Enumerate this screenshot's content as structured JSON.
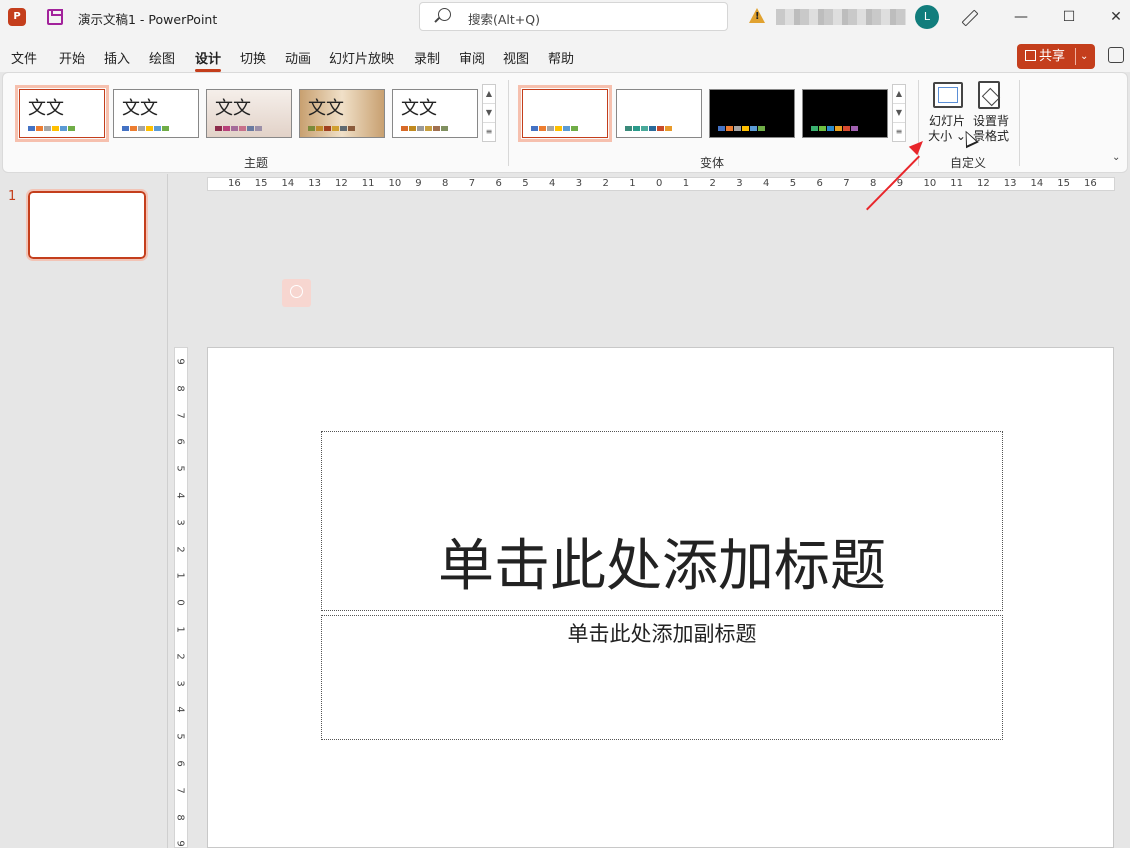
{
  "titlebar": {
    "app_logo": "P",
    "doc_title": "演示文稿1  -  PowerPoint",
    "search_placeholder": "搜索(Alt+Q)",
    "avatar_initial": "L",
    "minimize": "—",
    "maximize": "☐",
    "close": "✕"
  },
  "menu": {
    "items": [
      "文件",
      "开始",
      "插入",
      "绘图",
      "设计",
      "切换",
      "动画",
      "幻灯片放映",
      "录制",
      "审阅",
      "视图",
      "帮助"
    ],
    "active": "设计",
    "share_label": "共享",
    "share_chevron": "⌄"
  },
  "ribbon": {
    "themes_group_label": "主题",
    "variants_group_label": "变体",
    "customize_group_label": "自定义",
    "theme_thumb_text": "文文",
    "theme_thumbs": [
      {
        "text": "文文",
        "swatches": [
          "#4472c4",
          "#ed7d31",
          "#a5a5a5",
          "#ffc000",
          "#5b9bd5",
          "#70ad47"
        ]
      },
      {
        "text": "文文",
        "swatches": [
          "#4472c4",
          "#ed7d31",
          "#a5a5a5",
          "#ffc000",
          "#5b9bd5",
          "#70ad47"
        ]
      },
      {
        "text": "文文",
        "swatches": [
          "#8c2a4a",
          "#b8417a",
          "#a56c9a",
          "#c7708a",
          "#6a7aa0",
          "#9b8fa8"
        ]
      },
      {
        "text": "文文",
        "swatches": [
          "#7a8a3a",
          "#c08a2a",
          "#a04020",
          "#d0a030",
          "#606a70",
          "#8a5a3a"
        ]
      },
      {
        "text": "文文",
        "swatches": [
          "#d86a28",
          "#c08a20",
          "#9a9a9a",
          "#c8a040",
          "#a07050",
          "#809060"
        ]
      }
    ],
    "variant_swatches": [
      [
        "#4472c4",
        "#ed7d31",
        "#a5a5a5",
        "#ffc000",
        "#5b9bd5",
        "#70ad47"
      ],
      [
        "#3a8a7a",
        "#2a9a8a",
        "#4aaa9a",
        "#2a6a9a",
        "#c84a2a",
        "#e89a2a"
      ],
      [
        "#4472c4",
        "#ed7d31",
        "#a5a5a5",
        "#ffc000",
        "#5b9bd5",
        "#70ad47"
      ],
      [
        "#3ab070",
        "#70c040",
        "#2a8acc",
        "#e8a020",
        "#d84a30",
        "#a060b0"
      ]
    ],
    "slide_size_label_1": "幻灯片",
    "slide_size_label_2": "大小 ⌄",
    "bg_format_label_1": "设置背",
    "bg_format_label_2": "景格式",
    "collapse": "⌄"
  },
  "slides_pane": {
    "slide_number": "1"
  },
  "hruler_ticks": [
    "16",
    "15",
    "14",
    "13",
    "12",
    "11",
    "10",
    "9",
    "8",
    "7",
    "6",
    "5",
    "4",
    "3",
    "2",
    "1",
    "0",
    "1",
    "2",
    "3",
    "4",
    "5",
    "6",
    "7",
    "8",
    "9",
    "10",
    "11",
    "12",
    "13",
    "14",
    "15",
    "16"
  ],
  "vruler_ticks": [
    "9",
    "8",
    "7",
    "6",
    "5",
    "4",
    "3",
    "2",
    "1",
    "0",
    "1",
    "2",
    "3",
    "4",
    "5",
    "6",
    "7",
    "8",
    "9"
  ],
  "slide": {
    "title_placeholder": "单击此处添加标题",
    "subtitle_placeholder": "单击此处添加副标题"
  }
}
